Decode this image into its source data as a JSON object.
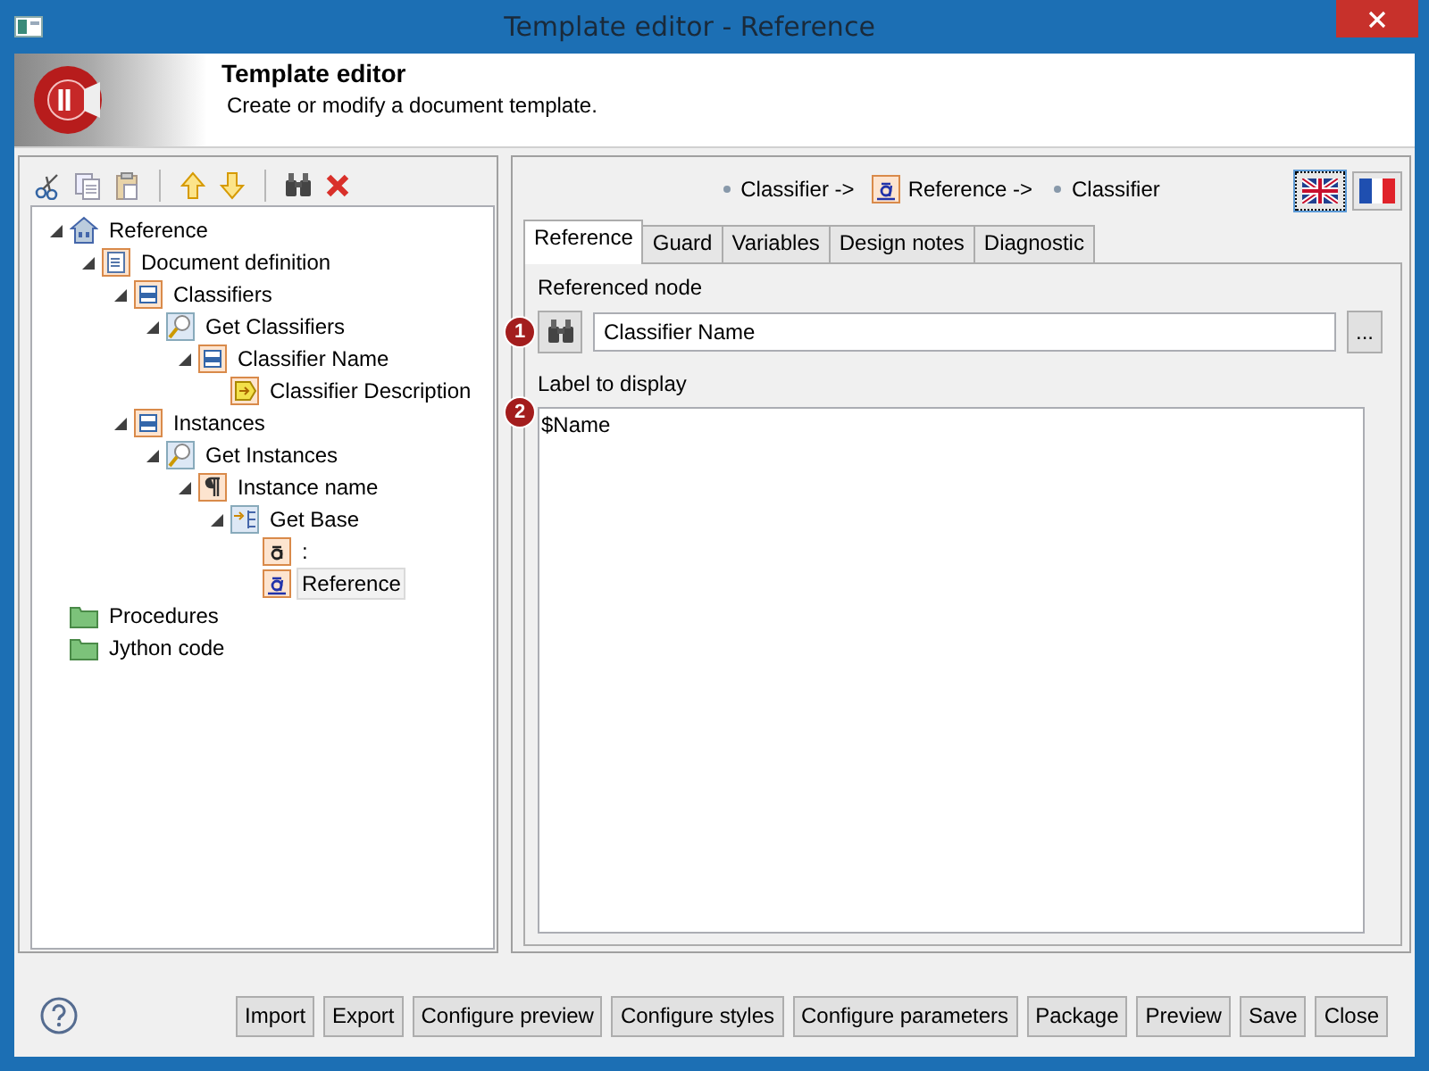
{
  "window": {
    "title": "Template editor - Reference"
  },
  "header": {
    "title": "Template editor",
    "subtitle": "Create or modify a document template."
  },
  "toolbar": [
    {
      "kind": "cut"
    },
    {
      "kind": "copy"
    },
    {
      "kind": "paste"
    },
    {
      "kind": "sep"
    },
    {
      "kind": "up"
    },
    {
      "kind": "down"
    },
    {
      "kind": "sep"
    },
    {
      "kind": "find"
    },
    {
      "kind": "delete"
    }
  ],
  "tree": [
    {
      "label": "Reference",
      "kind": "root",
      "expanded": true,
      "selected": false,
      "children": [
        {
          "label": "Document definition",
          "kind": "document",
          "expanded": true,
          "selected": false,
          "children": [
            {
              "label": "Classifiers",
              "kind": "section",
              "expanded": true,
              "selected": false,
              "children": [
                {
                  "label": "Get Classifiers",
                  "kind": "query",
                  "expanded": true,
                  "selected": false,
                  "children": [
                    {
                      "label": "Classifier Name",
                      "kind": "section",
                      "expanded": true,
                      "selected": false,
                      "children": [
                        {
                          "label": "Classifier Description",
                          "kind": "include",
                          "selected": false
                        }
                      ]
                    }
                  ]
                }
              ]
            },
            {
              "label": "Instances",
              "kind": "section",
              "expanded": true,
              "selected": false,
              "children": [
                {
                  "label": "Get Instances",
                  "kind": "query",
                  "expanded": true,
                  "selected": false,
                  "children": [
                    {
                      "label": "Instance name",
                      "kind": "paragraph",
                      "expanded": true,
                      "selected": false,
                      "children": [
                        {
                          "label": "Get Base",
                          "kind": "navigate",
                          "expanded": true,
                          "selected": false,
                          "children": [
                            {
                              "label": ":",
                              "kind": "text",
                              "selected": false
                            },
                            {
                              "label": "Reference",
                              "kind": "reference",
                              "selected": true
                            }
                          ]
                        }
                      ]
                    }
                  ]
                }
              ]
            }
          ]
        }
      ]
    },
    {
      "label": "Procedures",
      "kind": "folder",
      "selected": false
    },
    {
      "label": "Jython code",
      "kind": "folder",
      "selected": false
    }
  ],
  "breadcrumb": [
    {
      "label": "Classifier ->",
      "kind": "dot"
    },
    {
      "label": "Reference ->",
      "kind": "reference"
    },
    {
      "label": "Classifier",
      "kind": "dot"
    }
  ],
  "languages": [
    {
      "kind": "uk",
      "selected": true
    },
    {
      "kind": "fr",
      "selected": false
    }
  ],
  "tabs": [
    {
      "label": "Reference",
      "selected": true
    },
    {
      "label": "Guard",
      "selected": false
    },
    {
      "label": "Variables",
      "selected": false
    },
    {
      "label": "Design notes",
      "selected": false
    },
    {
      "label": "Diagnostic",
      "selected": false
    }
  ],
  "referenced_node": {
    "label": "Referenced node",
    "marker": "1",
    "value": "Classifier Name",
    "browse": "..."
  },
  "label_to_display": {
    "label": "Label to display",
    "marker": "2",
    "value": "$Name"
  },
  "buttons": [
    "Import",
    "Export",
    "Configure preview",
    "Configure styles",
    "Configure parameters",
    "Package",
    "Preview",
    "Save",
    "Close"
  ]
}
